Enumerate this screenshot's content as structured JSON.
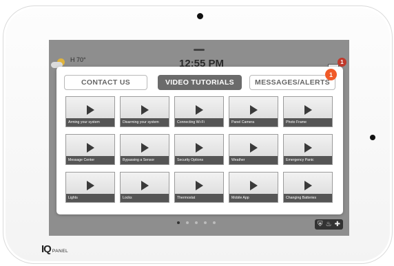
{
  "status_bar": {
    "temperature": "H 70°",
    "time": "12:55 PM",
    "mail_count": "1"
  },
  "tabs": [
    {
      "label": "CONTACT US"
    },
    {
      "label": "VIDEO TUTORIALS"
    },
    {
      "label": "MESSAGES/ALERTS",
      "badge": "1"
    }
  ],
  "videos": [
    {
      "label": "Arming your system"
    },
    {
      "label": "Disarming your system"
    },
    {
      "label": "Connecting Wi-Fi"
    },
    {
      "label": "Panel Camera"
    },
    {
      "label": "Photo Frame"
    },
    {
      "label": "Message Center"
    },
    {
      "label": "Bypassing a Sensor"
    },
    {
      "label": "Security Options"
    },
    {
      "label": "Weather"
    },
    {
      "label": "Emergency Panic"
    },
    {
      "label": "Lights"
    },
    {
      "label": "Locks"
    },
    {
      "label": "Thermostat"
    },
    {
      "label": "Mobile App"
    },
    {
      "label": "Changing Batteries"
    }
  ],
  "logo": {
    "main": "IQ",
    "sub": "PANEL"
  },
  "colors": {
    "active_tab": "#6b6b6b",
    "badge": "#f05a28",
    "screen_bg": "#8e8e8e"
  }
}
